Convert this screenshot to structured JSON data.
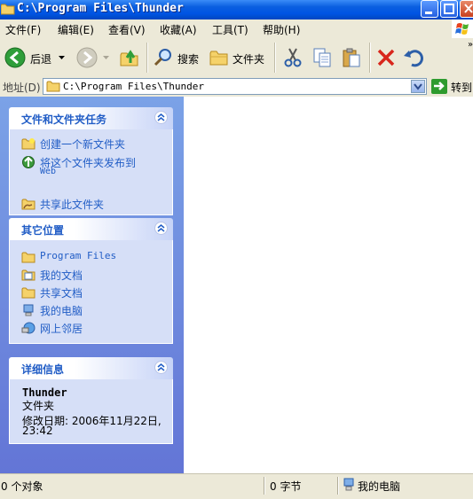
{
  "window": {
    "title": "C:\\Program Files\\Thunder",
    "controls": [
      "minimize",
      "maximize",
      "close"
    ]
  },
  "menu": [
    "文件(F)",
    "编辑(E)",
    "查看(V)",
    "收藏(A)",
    "工具(T)",
    "帮助(H)"
  ],
  "toolbar": {
    "back_label": "后退",
    "search_label": "搜索",
    "folders_label": "文件夹"
  },
  "address": {
    "label": "地址(D)",
    "value": "C:\\Program Files\\Thunder",
    "go_label": "转到"
  },
  "tasks": {
    "title": "文件和文件夹任务",
    "items": [
      {
        "label": "创建一个新文件夹",
        "icon": "new-folder-icon"
      },
      {
        "label": "将这个文件夹发布到",
        "label2": "Web",
        "icon": "publish-web-icon"
      },
      {
        "label": "共享此文件夹",
        "icon": "share-folder-icon"
      }
    ]
  },
  "places": {
    "title": "其它位置",
    "items": [
      {
        "label": "Program Files",
        "icon": "folder-icon"
      },
      {
        "label": "我的文档",
        "icon": "my-documents-icon"
      },
      {
        "label": "共享文档",
        "icon": "shared-documents-icon"
      },
      {
        "label": "我的电脑",
        "icon": "my-computer-icon"
      },
      {
        "label": "网上邻居",
        "icon": "network-places-icon"
      }
    ]
  },
  "details": {
    "title": "详细信息",
    "name": "Thunder",
    "type": "文件夹",
    "modified_line1": "修改日期: 2006年11月22日,",
    "modified_line2": "23:42"
  },
  "status": {
    "objects": "0 个对象",
    "size": "0 字节",
    "location": "我的电脑"
  },
  "colors": {
    "title_bar": "#0054e3",
    "task_pane": "#6f8fdf",
    "link": "#215dc6",
    "chrome": "#ece9d8"
  }
}
